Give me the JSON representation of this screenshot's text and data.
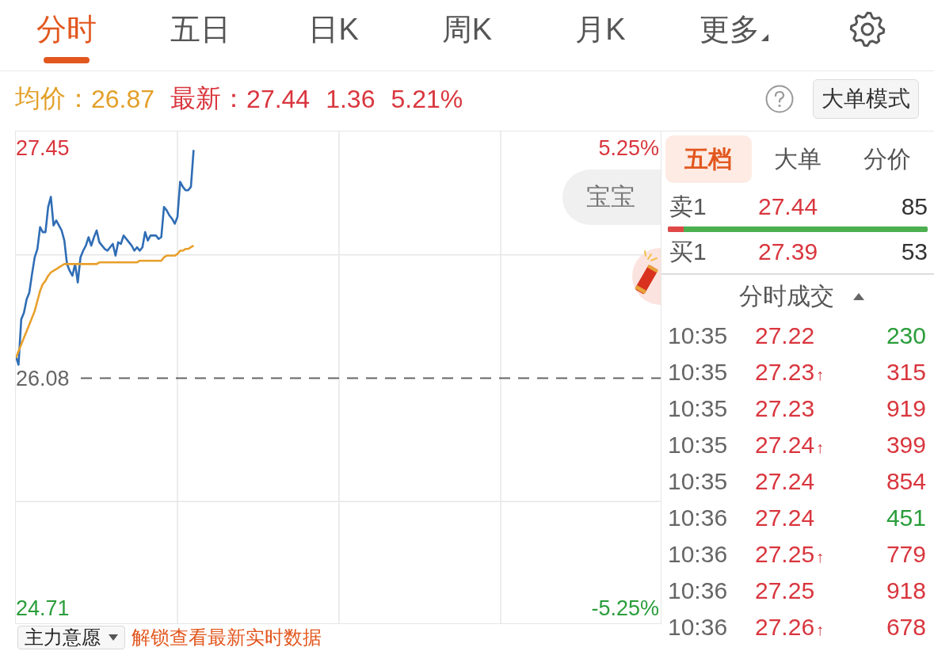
{
  "tabs": [
    {
      "label": "分时",
      "selected": true,
      "kind": "tab"
    },
    {
      "label": "五日",
      "selected": false,
      "kind": "tab"
    },
    {
      "label": "日K",
      "selected": false,
      "kind": "tab"
    },
    {
      "label": "周K",
      "selected": false,
      "kind": "tab"
    },
    {
      "label": "月K",
      "selected": false,
      "kind": "tab"
    },
    {
      "label": "更多",
      "selected": false,
      "kind": "menu"
    }
  ],
  "quote": {
    "avg_label": "均价：",
    "avg": "26.87",
    "last_label": "最新：",
    "last": "27.44",
    "change": "1.36",
    "change_pct": "5.21%"
  },
  "mode_button": "大单模式",
  "chart": {
    "bubble": "宝宝",
    "chart_data": [
      {
        "type": "line",
        "ylim": [
          24.61,
          27.55
        ],
        "yticks": [
          24.71,
          26.08,
          27.45
        ],
        "y2lim": [
          -5.63,
          5.63
        ],
        "y2ticks": [
          {
            "value": -5.25,
            "label": "-5.25%"
          },
          {
            "value": 5.25,
            "label": "5.25%"
          }
        ],
        "ref_lines": [
          {
            "axis": "y",
            "value": 26.08,
            "color": "#666666",
            "line_style": "dashed"
          }
        ],
        "series": [
          {
            "color": "#2f6db5",
            "values": [
              26.21,
              26.16,
              26.43,
              26.47,
              26.55,
              26.59,
              26.7,
              26.8,
              26.85,
              26.98,
              26.95,
              26.95,
              27.1,
              27.16,
              26.99,
              27.02,
              26.99,
              26.96,
              26.9,
              26.76,
              26.72,
              26.69,
              26.76,
              26.65,
              26.8,
              26.84,
              26.87,
              26.92,
              26.87,
              26.92,
              26.96,
              26.89,
              26.87,
              26.85,
              26.84,
              26.86,
              26.88,
              26.81,
              26.89,
              26.88,
              26.93,
              26.91,
              26.89,
              26.87,
              26.84,
              26.86,
              26.84,
              26.86,
              26.95,
              26.9,
              26.93,
              26.93,
              26.93,
              26.91,
              26.92,
              27.1,
              27.08,
              27.05,
              27.03,
              27.0,
              27.04,
              27.25,
              27.22,
              27.2,
              27.2,
              27.22,
              27.44,
              null,
              null,
              null,
              null,
              null,
              null,
              null,
              null,
              null,
              null,
              null,
              null,
              null,
              null,
              null,
              null,
              null,
              null,
              null,
              null,
              null,
              null,
              null,
              null,
              null,
              null,
              null,
              null,
              null,
              null,
              null,
              null,
              null,
              null,
              null,
              null,
              null,
              null,
              null,
              null,
              null,
              null,
              null,
              null,
              null,
              null,
              null,
              null,
              null,
              null,
              null,
              null,
              null,
              null,
              null,
              null,
              null,
              null,
              null,
              null,
              null,
              null,
              null,
              null,
              null,
              null,
              null,
              null,
              null,
              null,
              null,
              null,
              null,
              null,
              null,
              null,
              null,
              null,
              null,
              null,
              null,
              null,
              null,
              null,
              null,
              null,
              null,
              null,
              null,
              null,
              null,
              null,
              null,
              null,
              null,
              null,
              null,
              null,
              null,
              null,
              null,
              null,
              null,
              null,
              null,
              null,
              null,
              null,
              null,
              null,
              null,
              null,
              null,
              null,
              null,
              null,
              null,
              null,
              null,
              null,
              null,
              null,
              null,
              null,
              null,
              null,
              null,
              null,
              null,
              null,
              null,
              null,
              null,
              null,
              null,
              null,
              null,
              null,
              null,
              null,
              null,
              null,
              null,
              null,
              null,
              null,
              null,
              null,
              null,
              null,
              null,
              null,
              null,
              null,
              null,
              null,
              null,
              null,
              null,
              null,
              null,
              null,
              null,
              null,
              null,
              null,
              null,
              null,
              null,
              null,
              null,
              null,
              null,
              null
            ]
          },
          {
            "color": "#e8a02c",
            "values": [
              26.2,
              26.24,
              26.28,
              26.32,
              26.36,
              26.4,
              26.44,
              26.48,
              26.54,
              26.6,
              26.64,
              26.66,
              26.69,
              26.71,
              26.72,
              26.73,
              26.74,
              26.75,
              26.76,
              26.76,
              26.76,
              26.76,
              26.76,
              26.76,
              26.76,
              26.76,
              26.76,
              26.76,
              26.76,
              26.76,
              26.76,
              26.77,
              26.77,
              26.77,
              26.77,
              26.77,
              26.77,
              26.77,
              26.77,
              26.77,
              26.77,
              26.77,
              26.77,
              26.77,
              26.77,
              26.77,
              26.78,
              26.78,
              26.78,
              26.78,
              26.78,
              26.78,
              26.78,
              26.78,
              26.78,
              26.8,
              26.81,
              26.81,
              26.81,
              26.81,
              26.82,
              26.84,
              26.84,
              26.85,
              26.85,
              26.86,
              26.87,
              null,
              null,
              null,
              null,
              null,
              null,
              null,
              null,
              null,
              null,
              null,
              null,
              null,
              null,
              null,
              null,
              null,
              null,
              null,
              null,
              null,
              null,
              null,
              null,
              null,
              null,
              null,
              null,
              null,
              null,
              null,
              null,
              null,
              null,
              null,
              null,
              null,
              null,
              null,
              null,
              null,
              null,
              null,
              null,
              null,
              null,
              null,
              null,
              null,
              null,
              null,
              null,
              null,
              null,
              null,
              null,
              null,
              null,
              null,
              null,
              null,
              null,
              null,
              null,
              null,
              null,
              null,
              null,
              null,
              null,
              null,
              null,
              null,
              null,
              null,
              null,
              null,
              null,
              null,
              null,
              null,
              null,
              null,
              null,
              null,
              null,
              null,
              null,
              null,
              null,
              null,
              null,
              null,
              null,
              null,
              null,
              null,
              null,
              null,
              null,
              null,
              null,
              null,
              null,
              null,
              null,
              null,
              null,
              null,
              null,
              null,
              null,
              null,
              null,
              null,
              null,
              null,
              null,
              null,
              null,
              null,
              null,
              null,
              null,
              null,
              null,
              null,
              null,
              null,
              null,
              null,
              null,
              null,
              null,
              null,
              null,
              null,
              null,
              null,
              null,
              null,
              null,
              null,
              null,
              null,
              null,
              null,
              null,
              null,
              null,
              null,
              null,
              null,
              null,
              null,
              null,
              null,
              null,
              null,
              null,
              null,
              null,
              null,
              null,
              null,
              null,
              null,
              null,
              null,
              null,
              null,
              null,
              null,
              null
            ]
          }
        ]
      }
    ]
  },
  "book_tabs": [
    {
      "label": "五档",
      "selected": true
    },
    {
      "label": "大单",
      "selected": false
    },
    {
      "label": "分价",
      "selected": false
    }
  ],
  "order_book": [
    {
      "label": "卖1",
      "price": "27.44",
      "volume": "85"
    },
    {
      "label": "买1",
      "price": "27.39",
      "volume": "53"
    }
  ],
  "order_ratio": {
    "level": 0.06
  },
  "trades_header": {
    "title": "分时成交",
    "expanded": true
  },
  "trades": [
    {
      "time": "10:35",
      "price": "27.22",
      "volume": "230",
      "color": "#2a9d3a"
    },
    {
      "time": "10:35",
      "price": "27.23",
      "arrow": "↑",
      "volume": "315",
      "color": "#d9363e"
    },
    {
      "time": "10:35",
      "price": "27.23",
      "volume": "919",
      "color": "#d9363e"
    },
    {
      "time": "10:35",
      "price": "27.24",
      "arrow": "↑",
      "volume": "399",
      "color": "#d9363e"
    },
    {
      "time": "10:35",
      "price": "27.24",
      "volume": "854",
      "color": "#d9363e"
    },
    {
      "time": "10:36",
      "price": "27.24",
      "volume": "451",
      "color": "#2a9d3a"
    },
    {
      "time": "10:36",
      "price": "27.25",
      "arrow": "↑",
      "volume": "779",
      "color": "#d9363e"
    },
    {
      "time": "10:36",
      "price": "27.25",
      "volume": "918",
      "color": "#d9363e"
    },
    {
      "time": "10:36",
      "price": "27.26",
      "arrow": "↑",
      "volume": "678",
      "color": "#d9363e"
    }
  ],
  "indicator_dropdown": "主力意愿",
  "unlock_link": "解锁查看最新实时数据"
}
